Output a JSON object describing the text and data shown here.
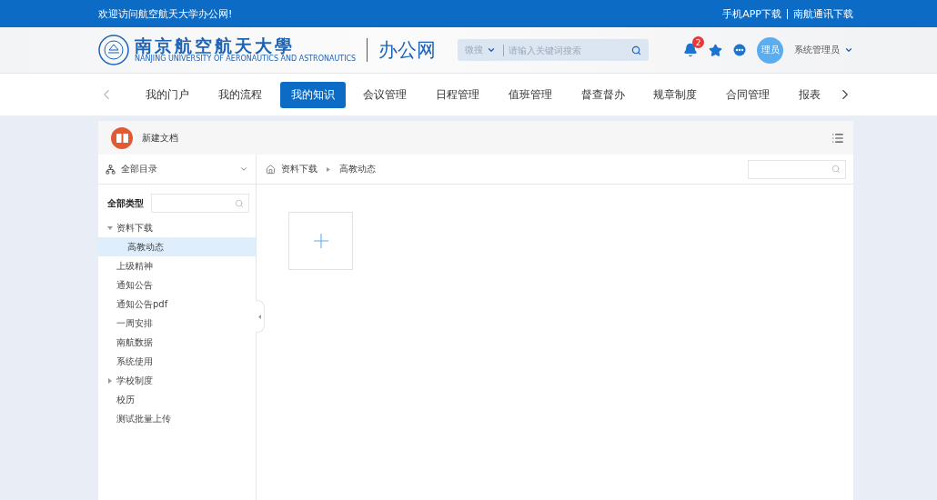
{
  "top_bar": {
    "welcome": "欢迎访问航空航天大学办公网!",
    "links": [
      "手机APP下载",
      "南航通讯下载"
    ]
  },
  "header": {
    "logo": {
      "name": "南京航空航天大學",
      "subtitle": "NANJING UNIVERSITY OF AERONAUTICS AND ASTRONAUTICS",
      "site": "办公网"
    },
    "search": {
      "scope": "微搜",
      "placeholder": "请输入关键词搜索"
    },
    "notifications": {
      "count": "2"
    },
    "user": {
      "avatar": "理员",
      "name": "系统管理员"
    }
  },
  "nav": {
    "tabs": [
      {
        "label": "我的门户",
        "selected": false
      },
      {
        "label": "我的流程",
        "selected": false
      },
      {
        "label": "我的知识",
        "selected": true
      },
      {
        "label": "会议管理",
        "selected": false
      },
      {
        "label": "日程管理",
        "selected": false
      },
      {
        "label": "值班管理",
        "selected": false
      },
      {
        "label": "督查督办",
        "selected": false
      },
      {
        "label": "规章制度",
        "selected": false
      },
      {
        "label": "合同管理",
        "selected": false
      },
      {
        "label": "报表",
        "selected": false
      }
    ]
  },
  "panel": {
    "title": "新建文档",
    "catalog": "全部目录",
    "type_label": "全部类型",
    "breadcrumb": [
      "资料下载",
      "高教动态"
    ],
    "tree": [
      {
        "label": "资料下载",
        "expanded": true,
        "selected": false,
        "children": [
          {
            "label": "高教动态",
            "selected": true
          }
        ]
      },
      {
        "label": "上级精神",
        "selected": false
      },
      {
        "label": "通知公告",
        "selected": false
      },
      {
        "label": "通知公告pdf",
        "selected": false
      },
      {
        "label": "一周安排",
        "selected": false
      },
      {
        "label": "南航数据",
        "selected": false
      },
      {
        "label": "系统使用",
        "selected": false
      },
      {
        "label": "学校制度",
        "expanded": false,
        "selected": false
      },
      {
        "label": "校历",
        "selected": false
      },
      {
        "label": "测试批量上传",
        "selected": false
      }
    ]
  }
}
